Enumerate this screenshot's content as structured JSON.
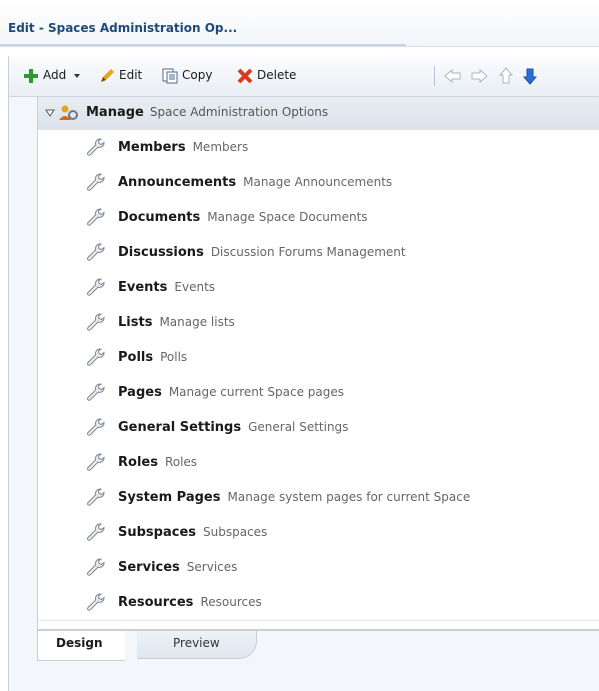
{
  "window": {
    "title": "Edit - Spaces Administration Op..."
  },
  "toolbar": {
    "add_label": "Add",
    "edit_label": "Edit",
    "copy_label": "Copy",
    "delete_label": "Delete",
    "icons": [
      "add-icon",
      "edit-icon",
      "copy-icon",
      "delete-icon",
      "arrow-left-icon",
      "arrow-right-icon",
      "arrow-up-icon",
      "arrow-down-icon"
    ]
  },
  "tree": {
    "root": {
      "name": "Manage",
      "description": "Space Administration Options",
      "expanded": true
    },
    "items": [
      {
        "name": "Members",
        "description": "Members"
      },
      {
        "name": "Announcements",
        "description": "Manage Announcements"
      },
      {
        "name": "Documents",
        "description": "Manage Space Documents"
      },
      {
        "name": "Discussions",
        "description": "Discussion Forums Management"
      },
      {
        "name": "Events",
        "description": "Events"
      },
      {
        "name": "Lists",
        "description": "Manage lists"
      },
      {
        "name": "Polls",
        "description": "Polls"
      },
      {
        "name": "Pages",
        "description": "Manage current Space pages"
      },
      {
        "name": "General Settings",
        "description": "General Settings"
      },
      {
        "name": "Roles",
        "description": "Roles"
      },
      {
        "name": "System Pages",
        "description": "Manage system pages for current Space"
      },
      {
        "name": "Subspaces",
        "description": "Subspaces"
      },
      {
        "name": "Services",
        "description": "Services"
      },
      {
        "name": "Resources",
        "description": "Resources"
      }
    ]
  },
  "tabs": [
    {
      "label": "Design",
      "active": true
    },
    {
      "label": "Preview",
      "active": false
    }
  ],
  "colors": {
    "title": "#1e4a7a",
    "accent_blue": "#2a6fd6",
    "add_green": "#2e9a2e",
    "delete_red": "#d93a1a"
  }
}
